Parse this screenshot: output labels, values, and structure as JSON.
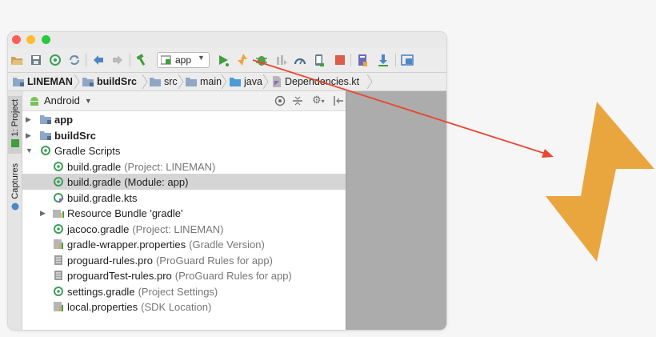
{
  "colors": {
    "accent_bolt": "#eaa63e",
    "arrow": "#e8472f",
    "run": "#3f9d3c",
    "gradle_green": "#3c9f59",
    "folder": "#8fa7c4",
    "stop": "#dd5c4a"
  },
  "toolbar": {
    "icons": [
      "folder-open-icon",
      "save-icon",
      "sync-icon",
      "refresh-icon",
      "back-icon",
      "forward-icon",
      "hammer-icon",
      "run-config-icon",
      "run-icon",
      "apply-changes-icon",
      "debug-icon",
      "attach-icon",
      "profile-icon",
      "device-icon",
      "stop-icon",
      "sdk-icon",
      "download-icon",
      "layout-icon"
    ],
    "run_config": "app"
  },
  "breadcrumbs": [
    {
      "label": "LINEMAN",
      "bold": true,
      "icon": "module-folder-icon"
    },
    {
      "label": "buildSrc",
      "bold": true,
      "icon": "module-folder-icon"
    },
    {
      "label": "src",
      "bold": false,
      "icon": "folder-icon"
    },
    {
      "label": "main",
      "bold": false,
      "icon": "folder-icon"
    },
    {
      "label": "java",
      "bold": false,
      "icon": "source-folder-icon"
    },
    {
      "label": "Dependencies.kt",
      "bold": false,
      "icon": "kotlin-file-icon"
    }
  ],
  "side_tabs": {
    "project": "1: Project",
    "captures": "Captures"
  },
  "project_view": {
    "selector": "Android",
    "header_icons": [
      "target-icon",
      "collapse-icon",
      "gear-icon",
      "hide-icon"
    ]
  },
  "tree": [
    {
      "label": "app",
      "hint": "",
      "bold": true,
      "icon": "module-folder-icon",
      "arrow": "▶",
      "indent": 0
    },
    {
      "label": "buildSrc",
      "hint": "",
      "bold": true,
      "icon": "module-folder-icon",
      "arrow": "▶",
      "indent": 0
    },
    {
      "label": "Gradle Scripts",
      "hint": "",
      "bold": false,
      "icon": "gradle-scripts-icon",
      "arrow": "▼",
      "indent": 0
    },
    {
      "label": "build.gradle",
      "hint": "(Project: LINEMAN)",
      "bold": false,
      "icon": "gradle-file-icon",
      "arrow": "",
      "indent": 1
    },
    {
      "label": "build.gradle",
      "hint": "(Module: app)",
      "bold": false,
      "icon": "gradle-file-icon",
      "arrow": "",
      "indent": 1,
      "selected": true
    },
    {
      "label": "build.gradle.kts",
      "hint": "",
      "bold": false,
      "icon": "gradle-kts-icon",
      "arrow": "",
      "indent": 1
    },
    {
      "label": "Resource Bundle 'gradle'",
      "hint": "",
      "bold": false,
      "icon": "resource-bundle-icon",
      "arrow": "▶",
      "indent": 1
    },
    {
      "label": "jacoco.gradle",
      "hint": "(Project: LINEMAN)",
      "bold": false,
      "icon": "gradle-file-icon",
      "arrow": "",
      "indent": 1
    },
    {
      "label": "gradle-wrapper.properties",
      "hint": "(Gradle Version)",
      "bold": false,
      "icon": "properties-file-icon",
      "arrow": "",
      "indent": 1
    },
    {
      "label": "proguard-rules.pro",
      "hint": "(ProGuard Rules for app)",
      "bold": false,
      "icon": "text-file-icon",
      "arrow": "",
      "indent": 1
    },
    {
      "label": "proguardTest-rules.pro",
      "hint": "(ProGuard Rules for app)",
      "bold": false,
      "icon": "text-file-icon",
      "arrow": "",
      "indent": 1
    },
    {
      "label": "settings.gradle",
      "hint": "(Project Settings)",
      "bold": false,
      "icon": "gradle-file-icon",
      "arrow": "",
      "indent": 1
    },
    {
      "label": "local.properties",
      "hint": "(SDK Location)",
      "bold": false,
      "icon": "properties-file-icon",
      "arrow": "",
      "indent": 1
    }
  ],
  "callout": {
    "icon": "lightning-bolt-icon"
  }
}
